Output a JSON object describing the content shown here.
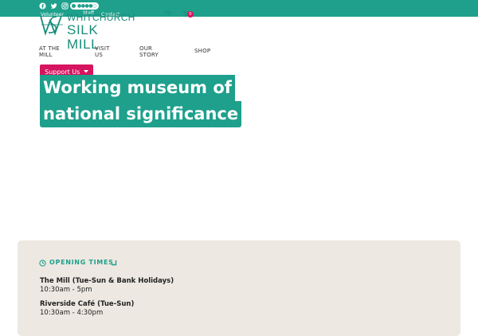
{
  "colors": {
    "brand_teal": "#1ea08c",
    "accent_pink": "#d6145f",
    "panel_bg": "#ede8e1"
  },
  "topbar": {
    "social_icons": [
      "facebook-icon",
      "twitter-icon",
      "instagram-icon"
    ],
    "tripadvisor": {
      "icon": "tripadvisor-icon",
      "rating": "●●●●○"
    },
    "volunteer_label": "Volunteer",
    "staff_label": "Staff",
    "contact_label": "Contact",
    "my_label": "My",
    "cart": {
      "icon": "cart-icon",
      "count": "0"
    }
  },
  "logo": {
    "line1": "WHITCHURCH",
    "line2": "SILK MILL",
    "icon": "wsm-monogram-icon"
  },
  "nav": [
    {
      "label_line1": "AT THE",
      "label_line2": "MILL"
    },
    {
      "label_line1": "VISIT",
      "label_line2": "US"
    },
    {
      "label_line1": "OUR",
      "label_line2": "STORY"
    },
    {
      "label_line1": "SHOP",
      "label_line2": ""
    }
  ],
  "support": {
    "label": "Support Us",
    "icon": "caret-down-icon"
  },
  "hero": {
    "line1": "Working museum of",
    "line2": "national significance"
  },
  "opening": {
    "icon": "clock-icon",
    "title": "OPENING TIMES",
    "toggle_icon": "corner-arrow-icon",
    "venues": [
      {
        "name": "The Mill (Tue-Sun & Bank Holidays)",
        "hours": "10:30am - 5pm"
      },
      {
        "name": "Riverside Café (Tue-Sun)",
        "hours": "10:30am - 4:30pm"
      }
    ]
  }
}
